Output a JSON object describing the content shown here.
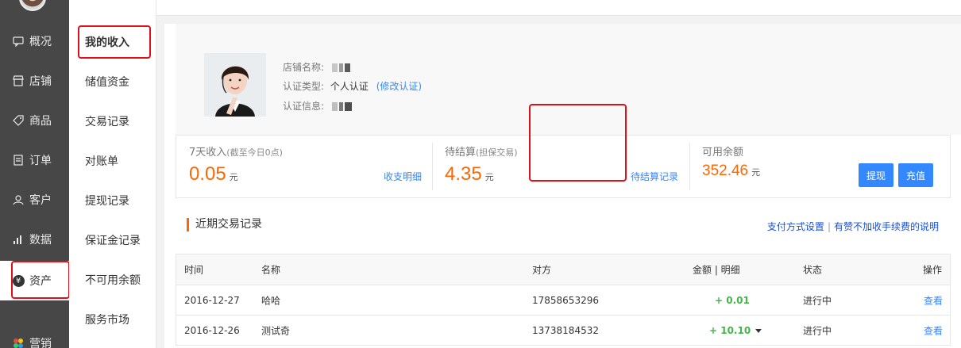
{
  "primary_nav": [
    {
      "label": "概况",
      "icon": "chat-icon"
    },
    {
      "label": "店铺",
      "icon": "store-icon"
    },
    {
      "label": "商品",
      "icon": "tag-icon"
    },
    {
      "label": "订单",
      "icon": "list-icon"
    },
    {
      "label": "客户",
      "icon": "user-icon"
    },
    {
      "label": "数据",
      "icon": "bar-chart-icon"
    },
    {
      "label": "资产",
      "icon": "yen-coin-icon",
      "active": true
    },
    {
      "label": "营销",
      "icon": "marketing-icon"
    }
  ],
  "secondary_nav": [
    {
      "label": "我的收入",
      "active": true
    },
    {
      "label": "储值资金"
    },
    {
      "label": "交易记录"
    },
    {
      "label": "对账单"
    },
    {
      "label": "提现记录"
    },
    {
      "label": "保证金记录"
    },
    {
      "label": "不可用余额"
    },
    {
      "label": "服务市场"
    }
  ],
  "shop_info": {
    "name_label": "店铺名称:",
    "auth_type_label": "认证类型:",
    "auth_type_value": "个人认证",
    "auth_modify_link": "(修改认证)",
    "auth_info_label": "认证信息:"
  },
  "stats": {
    "income_7d_label": "7天收入",
    "income_7d_note": "(截至今日0点)",
    "income_7d_value": "0.05",
    "income_7d_unit": "元",
    "income_7d_link": "收支明细",
    "pending_label": "待结算",
    "pending_note": "(担保交易)",
    "pending_value": "4.35",
    "pending_unit": "元",
    "pending_link": "待结算记录",
    "available_label": "可用余额",
    "available_value": "352.46",
    "available_unit": "元",
    "withdraw_button": "提现",
    "recharge_button": "充值"
  },
  "transactions": {
    "title": "近期交易记录",
    "link_payment": "支付方式设置",
    "link_separator": "|",
    "link_fee": "有赞不加收手续费的说明",
    "columns": [
      "时间",
      "名称",
      "对方",
      "金额 | 明细",
      "状态",
      "操作"
    ],
    "rows": [
      {
        "time": "2016-12-27",
        "name": "哈哈",
        "party": "17858653296",
        "amount": "+ 0.01",
        "status": "进行中",
        "action": "查看",
        "has_caret": false
      },
      {
        "time": "2016-12-26",
        "name": "测试奇",
        "party": "13738184532",
        "amount": "+ 10.10",
        "status": "进行中",
        "action": "查看",
        "has_caret": true
      }
    ]
  },
  "colors": {
    "accent": "#3388ff",
    "amount_orange": "#ff6600",
    "positive_green": "#44b549",
    "annotation_red": "#e0101b"
  }
}
